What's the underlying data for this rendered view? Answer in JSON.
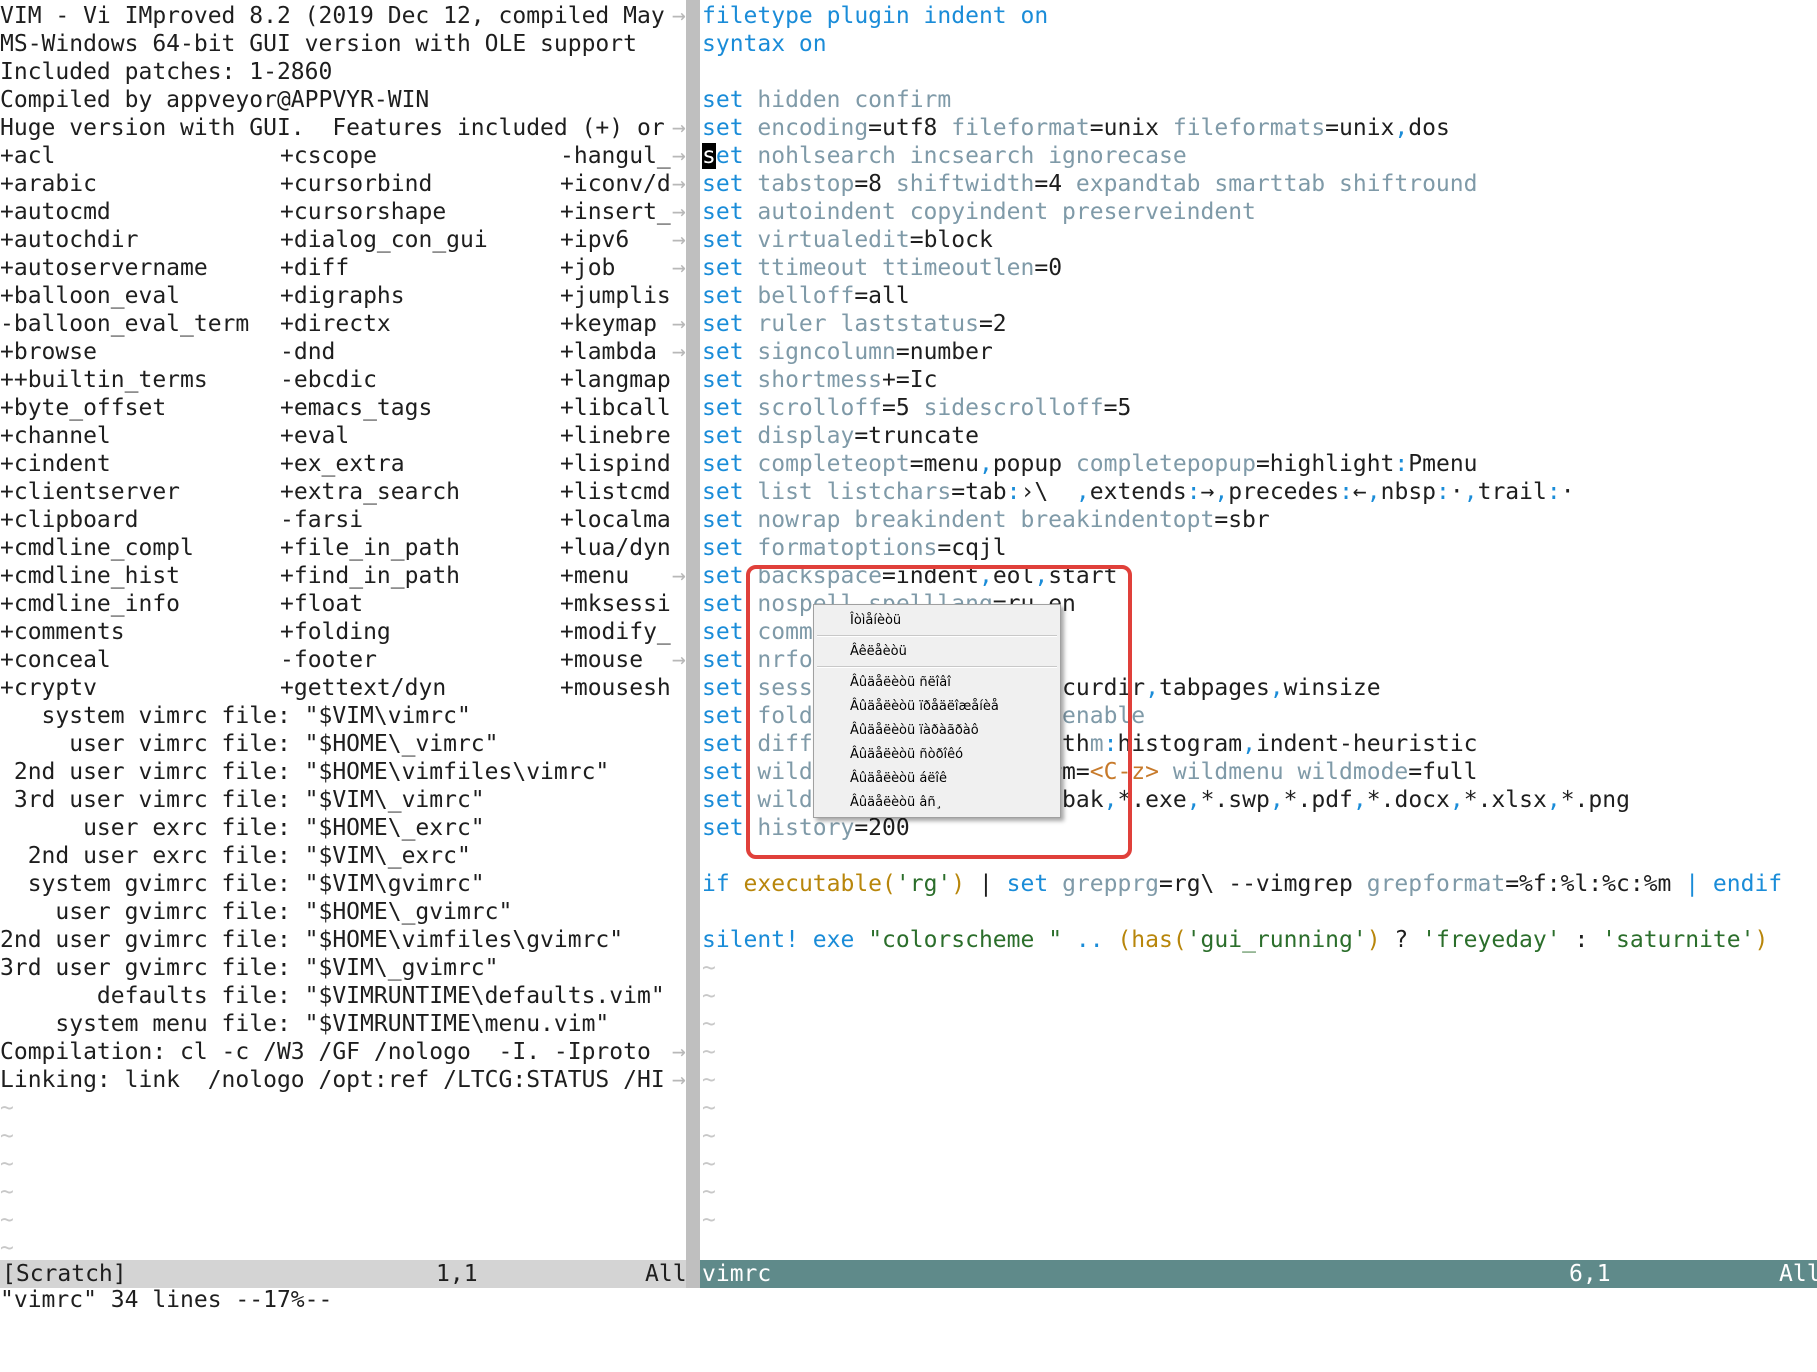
{
  "left": {
    "version_lines": [
      "VIM - Vi IMproved 8.2 (2019 Dec 12, compiled May",
      "MS-Windows 64-bit GUI version with OLE support",
      "Included patches: 1-2860",
      "Compiled by appveyor@APPVYR-WIN",
      "Huge version with GUI.  Features included (+) or"
    ],
    "features": [
      [
        "+acl",
        "+cscope",
        "-hangul_"
      ],
      [
        "+arabic",
        "+cursorbind",
        "+iconv/d"
      ],
      [
        "+autocmd",
        "+cursorshape",
        "+insert_"
      ],
      [
        "+autochdir",
        "+dialog_con_gui",
        "+ipv6"
      ],
      [
        "+autoservername",
        "+diff",
        "+job"
      ],
      [
        "+balloon_eval",
        "+digraphs",
        "+jumplis"
      ],
      [
        "-balloon_eval_term",
        "+directx",
        "+keymap"
      ],
      [
        "+browse",
        "-dnd",
        "+lambda"
      ],
      [
        "++builtin_terms",
        "-ebcdic",
        "+langmap"
      ],
      [
        "+byte_offset",
        "+emacs_tags",
        "+libcall"
      ],
      [
        "+channel",
        "+eval",
        "+linebre"
      ],
      [
        "+cindent",
        "+ex_extra",
        "+lispind"
      ],
      [
        "+clientserver",
        "+extra_search",
        "+listcmd"
      ],
      [
        "+clipboard",
        "-farsi",
        "+localma"
      ],
      [
        "+cmdline_compl",
        "+file_in_path",
        "+lua/dyn"
      ],
      [
        "+cmdline_hist",
        "+find_in_path",
        "+menu"
      ],
      [
        "+cmdline_info",
        "+float",
        "+mksessi"
      ],
      [
        "+comments",
        "+folding",
        "+modify_"
      ],
      [
        "+conceal",
        "-footer",
        "+mouse"
      ],
      [
        "+cryptv",
        "+gettext/dyn",
        "+mousesh"
      ]
    ],
    "vimrc_lines": [
      "   system vimrc file: \"$VIM\\vimrc\"",
      "     user vimrc file: \"$HOME\\_vimrc\"",
      " 2nd user vimrc file: \"$HOME\\vimfiles\\vimrc\"",
      " 3rd user vimrc file: \"$VIM\\_vimrc\"",
      "      user exrc file: \"$HOME\\_exrc\"",
      "  2nd user exrc file: \"$VIM\\_exrc\"",
      "  system gvimrc file: \"$VIM\\gvimrc\"",
      "    user gvimrc file: \"$HOME\\_gvimrc\"",
      "2nd user gvimrc file: \"$HOME\\vimfiles\\gvimrc\"",
      "3rd user gvimrc file: \"$VIM\\_gvimrc\"",
      "       defaults file: \"$VIMRUNTIME\\defaults.vim\"",
      "    system menu file: \"$VIMRUNTIME\\menu.vim\"",
      "Compilation: cl -c /W3 /GF /nologo  -I. -Iproto",
      "Linking: link  /nologo /opt:ref /LTCG:STATUS /HI"
    ],
    "trunc_marker": "→",
    "tilde": "~",
    "tilde_count": 6,
    "status": {
      "name": "[Scratch]",
      "pos": "1,1",
      "scroll": "All"
    }
  },
  "right": {
    "lines": [
      [
        [
          "filetype plugin indent on",
          "c-cyan"
        ]
      ],
      [
        [
          "syntax on",
          "c-cyan"
        ]
      ],
      [],
      [
        [
          "set",
          "c-cyan"
        ],
        [
          " hidden confirm",
          "c-opt"
        ]
      ],
      [
        [
          "set",
          "c-cyan"
        ],
        [
          " encoding",
          "c-opt"
        ],
        [
          "=utf8 ",
          ""
        ],
        [
          "fileformat",
          "c-opt"
        ],
        [
          "=unix ",
          ""
        ],
        [
          "fileformats",
          "c-opt"
        ],
        [
          "=unix",
          ""
        ],
        [
          ",",
          "c-cyan"
        ],
        [
          "dos",
          ""
        ]
      ],
      [
        [
          "s",
          "cursor"
        ],
        [
          "et",
          "c-cyan"
        ],
        [
          " nohlsearch incsearch ignorecase",
          "c-opt"
        ]
      ],
      [
        [
          "set",
          "c-cyan"
        ],
        [
          " tabstop",
          "c-opt"
        ],
        [
          "=8 ",
          ""
        ],
        [
          "shiftwidth",
          "c-opt"
        ],
        [
          "=4 ",
          ""
        ],
        [
          "expandtab smarttab shiftround",
          "c-opt"
        ]
      ],
      [
        [
          "set",
          "c-cyan"
        ],
        [
          " autoindent copyindent preserveindent",
          "c-opt"
        ]
      ],
      [
        [
          "set",
          "c-cyan"
        ],
        [
          " virtualedit",
          "c-opt"
        ],
        [
          "=block",
          ""
        ]
      ],
      [
        [
          "set",
          "c-cyan"
        ],
        [
          " ttimeout ttimeoutlen",
          "c-opt"
        ],
        [
          "=0",
          ""
        ]
      ],
      [
        [
          "set",
          "c-cyan"
        ],
        [
          " belloff",
          "c-opt"
        ],
        [
          "=all",
          ""
        ]
      ],
      [
        [
          "set",
          "c-cyan"
        ],
        [
          " ruler laststatus",
          "c-opt"
        ],
        [
          "=2",
          ""
        ]
      ],
      [
        [
          "set",
          "c-cyan"
        ],
        [
          " signcolumn",
          "c-opt"
        ],
        [
          "=number",
          ""
        ]
      ],
      [
        [
          "set",
          "c-cyan"
        ],
        [
          " shortmess",
          "c-opt"
        ],
        [
          "+=Ic",
          ""
        ]
      ],
      [
        [
          "set",
          "c-cyan"
        ],
        [
          " scrolloff",
          "c-opt"
        ],
        [
          "=5 ",
          ""
        ],
        [
          "sidescrolloff",
          "c-opt"
        ],
        [
          "=5",
          ""
        ]
      ],
      [
        [
          "set",
          "c-cyan"
        ],
        [
          " display",
          "c-opt"
        ],
        [
          "=truncate",
          ""
        ]
      ],
      [
        [
          "set",
          "c-cyan"
        ],
        [
          " completeopt",
          "c-opt"
        ],
        [
          "=menu",
          ""
        ],
        [
          ",",
          "c-cyan"
        ],
        [
          "popup ",
          ""
        ],
        [
          "completepopup",
          "c-opt"
        ],
        [
          "=highlight",
          ""
        ],
        [
          ":",
          "c-cyan"
        ],
        [
          "Pmenu",
          ""
        ]
      ],
      [
        [
          "set",
          "c-cyan"
        ],
        [
          " list listchars",
          "c-opt"
        ],
        [
          "=tab",
          ""
        ],
        [
          ":",
          "c-cyan"
        ],
        [
          "›\\  ",
          ""
        ],
        [
          ",",
          "c-cyan"
        ],
        [
          "extends",
          ""
        ],
        [
          ":",
          "c-cyan"
        ],
        [
          "→",
          ""
        ],
        [
          ",",
          "c-cyan"
        ],
        [
          "precedes",
          ""
        ],
        [
          ":",
          "c-cyan"
        ],
        [
          "←",
          ""
        ],
        [
          ",",
          "c-cyan"
        ],
        [
          "nbsp",
          ""
        ],
        [
          ":",
          "c-cyan"
        ],
        [
          "·",
          ""
        ],
        [
          ",",
          "c-cyan"
        ],
        [
          "trail",
          ""
        ],
        [
          ":",
          "c-cyan"
        ],
        [
          "·",
          ""
        ]
      ],
      [
        [
          "set",
          "c-cyan"
        ],
        [
          " nowrap breakindent breakindentopt",
          "c-opt"
        ],
        [
          "=sbr",
          ""
        ]
      ],
      [
        [
          "set",
          "c-cyan"
        ],
        [
          " formatoptions",
          "c-opt"
        ],
        [
          "=cqjl",
          ""
        ]
      ],
      [
        [
          "set",
          "c-cyan"
        ],
        [
          " backspace",
          "c-opt"
        ],
        [
          "=indent",
          ""
        ],
        [
          ",",
          "c-cyan"
        ],
        [
          "eol",
          ""
        ],
        [
          ",",
          "c-cyan"
        ],
        [
          "start",
          ""
        ]
      ],
      [
        [
          "set",
          "c-cyan"
        ],
        [
          " nospell spelllang",
          "c-opt"
        ],
        [
          "=ru",
          ""
        ],
        [
          ",",
          "c-cyan"
        ],
        [
          "en",
          ""
        ]
      ],
      [
        [
          "set",
          "c-cyan"
        ],
        [
          " comm",
          "c-opt"
        ]
      ],
      [
        [
          "set",
          "c-cyan"
        ],
        [
          " nrfo",
          "c-opt"
        ]
      ],
      [
        [
          "set",
          "c-cyan"
        ],
        [
          " sess",
          "c-opt"
        ],
        [
          "                s",
          ""
        ],
        [
          ",",
          "c-cyan"
        ],
        [
          "curdir",
          ""
        ],
        [
          ",",
          "c-cyan"
        ],
        [
          "tabpages",
          ""
        ],
        [
          ",",
          "c-cyan"
        ],
        [
          "winsize",
          ""
        ]
      ],
      [
        [
          "set",
          "c-cyan"
        ],
        [
          " fold",
          "c-opt"
        ],
        [
          "                ",
          ""
        ],
        [
          "ldenable",
          "c-opt"
        ]
      ],
      [
        [
          "set",
          "c-cyan"
        ],
        [
          " diff",
          "c-opt"
        ],
        [
          "                rith",
          ""
        ],
        [
          "m",
          "c-opt"
        ],
        [
          ":",
          "c-cyan"
        ],
        [
          "histogram",
          ""
        ],
        [
          ",",
          "c-cyan"
        ],
        [
          "indent-heuristic",
          ""
        ]
      ],
      [
        [
          "set",
          "c-cyan"
        ],
        [
          " wild",
          "c-opt"
        ],
        [
          "                arm",
          ""
        ],
        [
          "=",
          ""
        ],
        [
          "<C-z>",
          "c-orange"
        ],
        [
          " wildmenu wildmode",
          "c-opt"
        ],
        [
          "=full",
          ""
        ]
      ],
      [
        [
          "set",
          "c-cyan"
        ],
        [
          " wild",
          "c-opt"
        ],
        [
          "                *.bak",
          ""
        ],
        [
          ",",
          "c-cyan"
        ],
        [
          "*.exe",
          ""
        ],
        [
          ",",
          "c-cyan"
        ],
        [
          "*.swp",
          ""
        ],
        [
          ",",
          "c-cyan"
        ],
        [
          "*.pdf",
          ""
        ],
        [
          ",",
          "c-cyan"
        ],
        [
          "*.docx",
          ""
        ],
        [
          ",",
          "c-cyan"
        ],
        [
          "*.xlsx",
          ""
        ],
        [
          ",",
          "c-cyan"
        ],
        [
          "*.png",
          ""
        ]
      ],
      [
        [
          "set",
          "c-cyan"
        ],
        [
          " history",
          "c-opt"
        ],
        [
          "=200",
          ""
        ]
      ],
      [],
      [
        [
          "if",
          "c-cyan"
        ],
        [
          " executable(",
          "c-fn"
        ],
        [
          "'rg'",
          "c-str"
        ],
        [
          ")",
          "c-fn"
        ],
        [
          " | ",
          ""
        ],
        [
          "set",
          "c-cyan"
        ],
        [
          " grepprg",
          "c-opt"
        ],
        [
          "=rg\\ --vimgrep ",
          ""
        ],
        [
          "grepformat",
          "c-opt"
        ],
        [
          "=%f:%l:%c:%m ",
          ""
        ],
        [
          "| endif",
          "c-cyan"
        ]
      ],
      [],
      [
        [
          "silent!",
          "c-cyan"
        ],
        [
          " exe ",
          "c-cyan"
        ],
        [
          "\"colorscheme \"",
          "c-str"
        ],
        [
          " .. ",
          "c-cyan"
        ],
        [
          "(has(",
          "c-fn"
        ],
        [
          "'gui_running'",
          "c-str"
        ],
        [
          ")",
          "c-fn"
        ],
        [
          " ? ",
          ""
        ],
        [
          "'freyeday'",
          "c-str"
        ],
        [
          " : ",
          ""
        ],
        [
          "'saturnite'",
          "c-str"
        ],
        [
          ")",
          "c-fn"
        ]
      ]
    ],
    "tilde": "~",
    "tilde_count": 10,
    "status": {
      "name": "vimrc",
      "pos": "6,1",
      "scroll": "All"
    }
  },
  "context_menu": {
    "items": [
      "Îòìåíèòü",
      "Âêëåèòü",
      "Âûäåëèòü ñëîâî",
      "Âûäåëèòü ïðåäëîæåíèå",
      "Âûäåëèòü ïàðàãðàô",
      "Âûäåëèòü ñòðîêó",
      "Âûäåëèòü áëîê",
      "Âûäåëèòü âñ¸"
    ]
  },
  "cmdline": "\"vimrc\" 34 lines --17%--"
}
